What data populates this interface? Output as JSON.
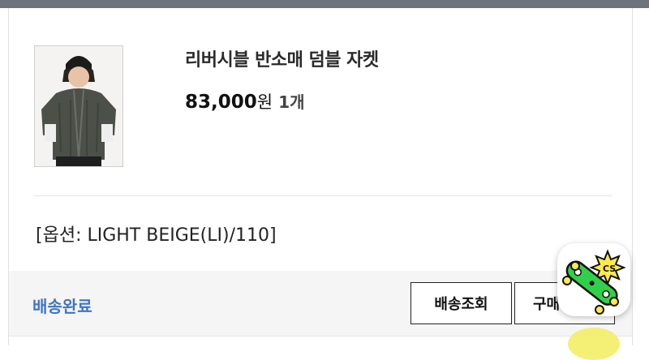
{
  "product": {
    "name": "리버시블 반소매 덤블 자켓",
    "price": "83,000",
    "currency_unit": "원",
    "quantity": "1개",
    "option": "[옵션: LIGHT BEIGE(LI)/110]"
  },
  "footer": {
    "status": "배송완료",
    "track_button": "배송조회",
    "buy_button": "구매확정"
  },
  "colors": {
    "status_blue": "#3f74c6",
    "footer_bg": "#f5f5f5",
    "badge_green": "#2fd14a"
  },
  "icons": {
    "product_photo": "jacket-photo",
    "cs_badge": "skateboard-cs-icon"
  }
}
